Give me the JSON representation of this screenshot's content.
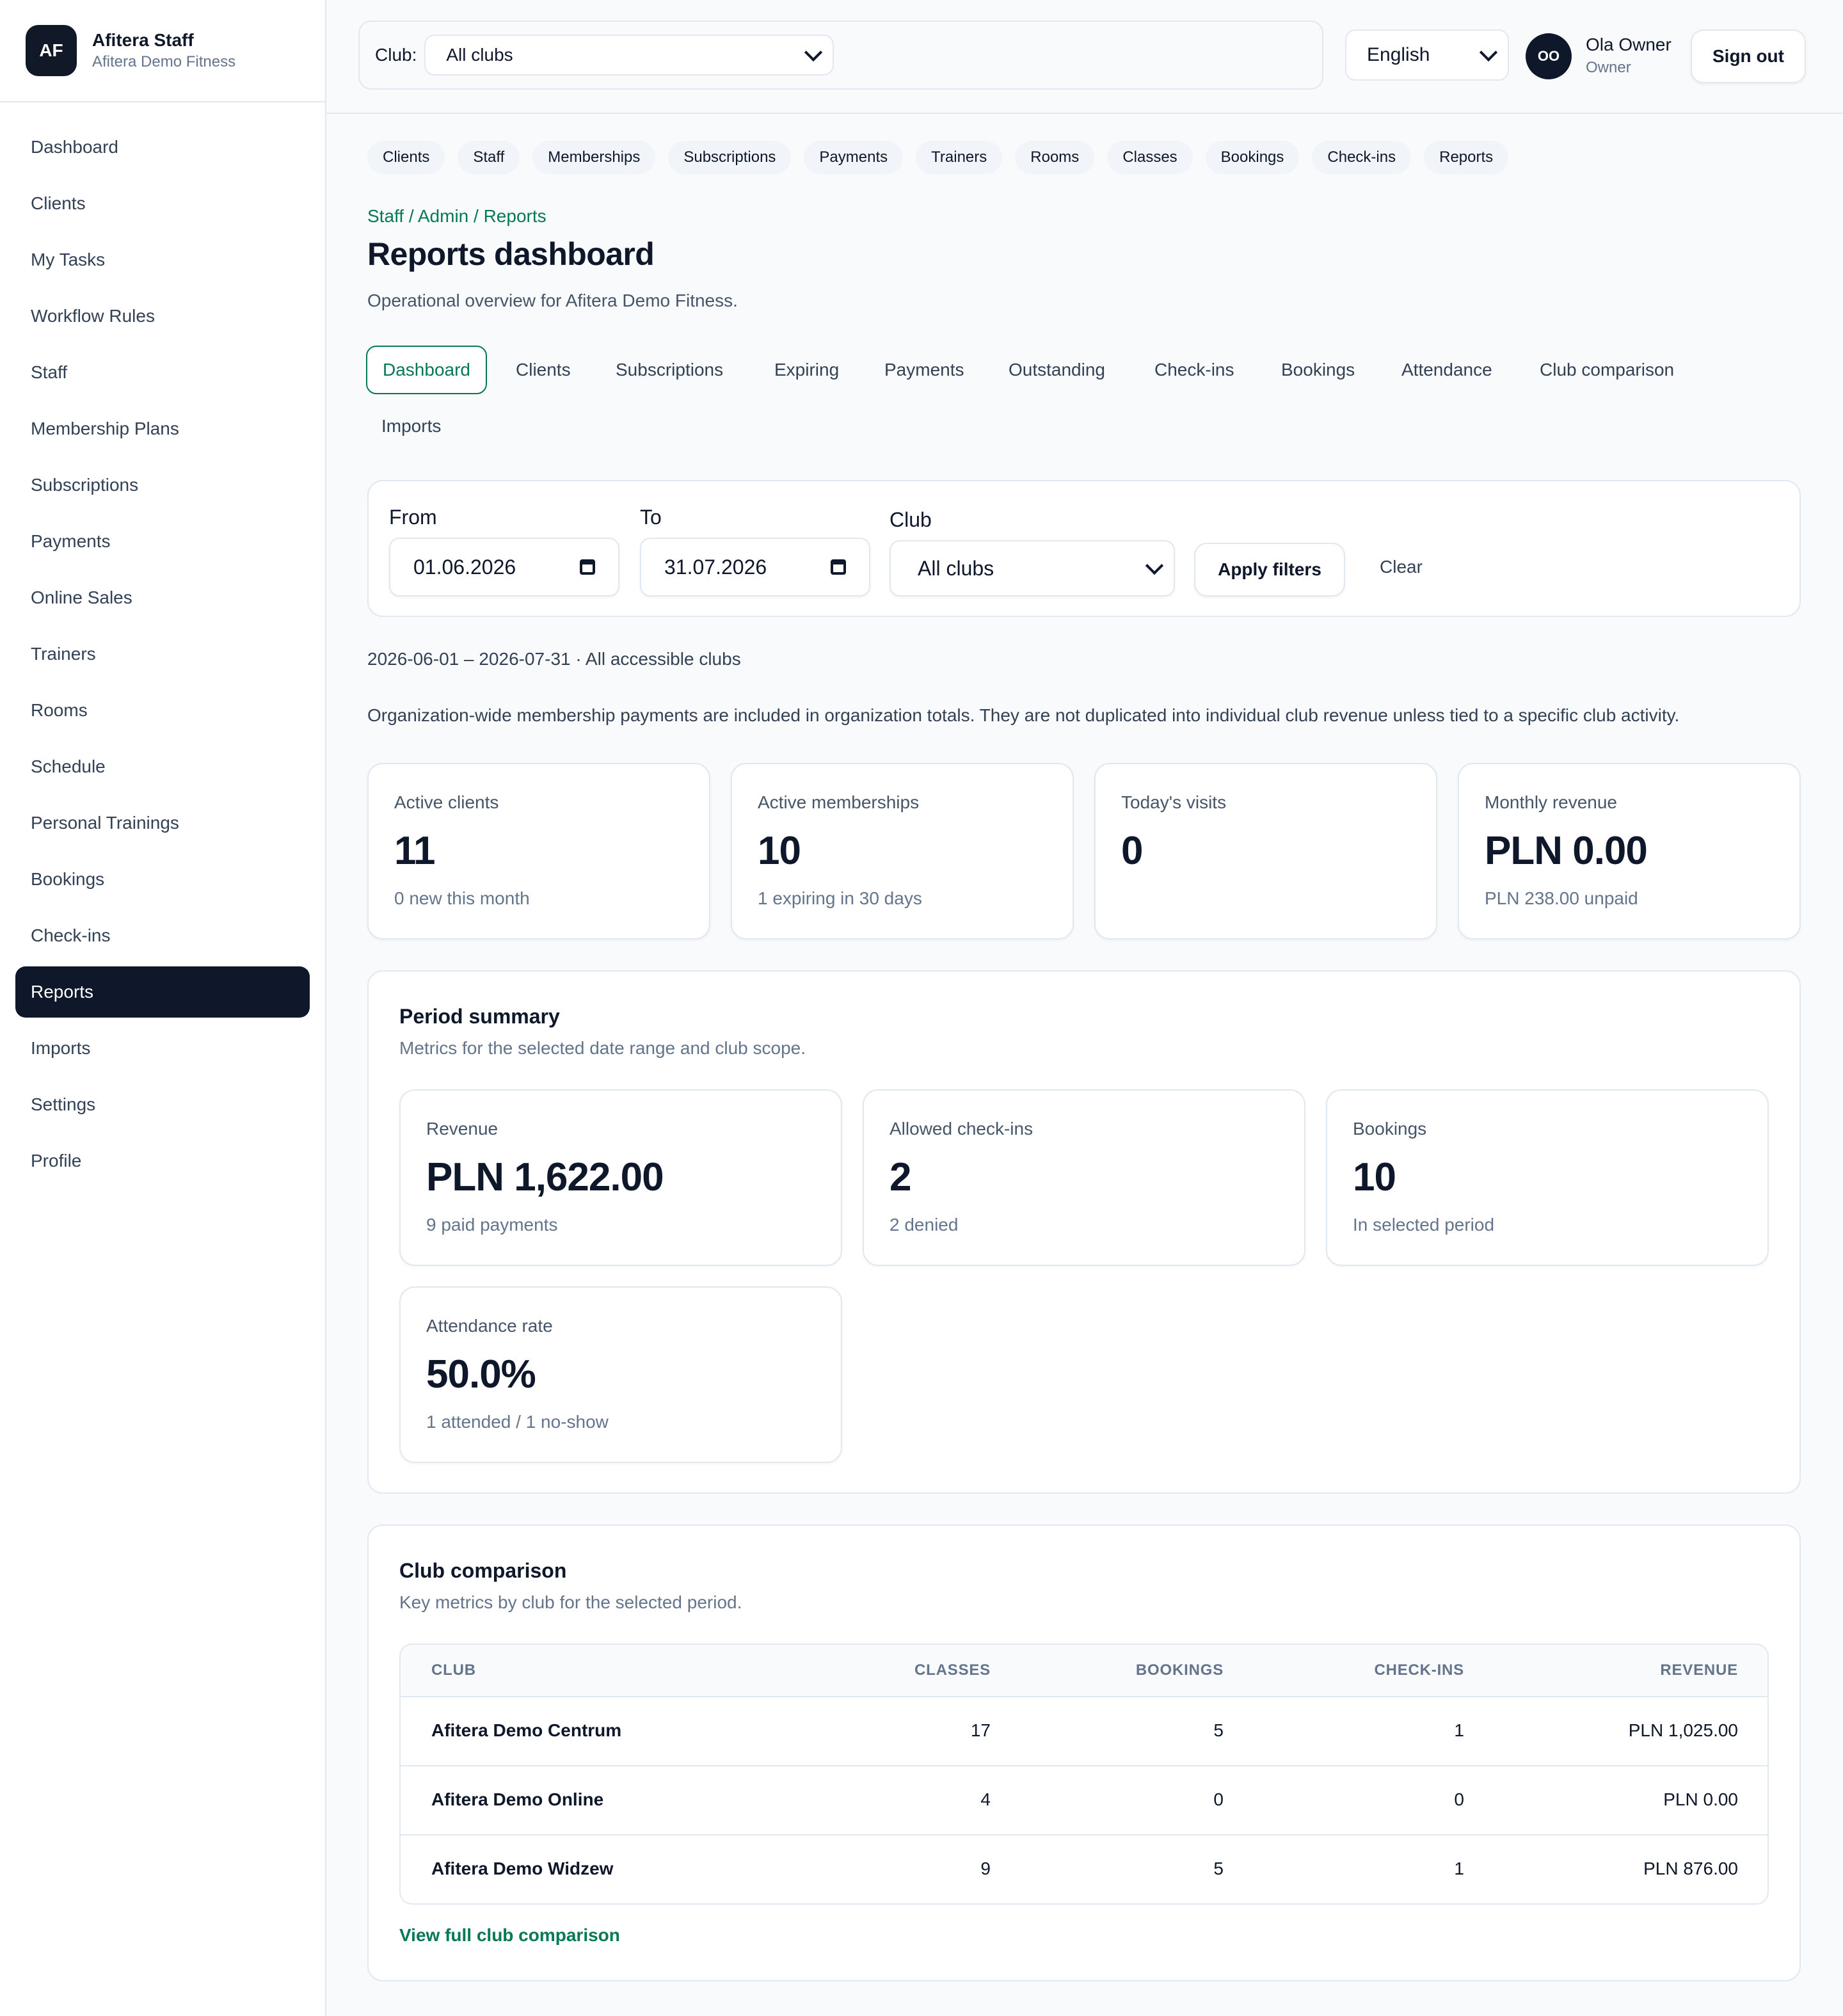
{
  "brand": {
    "initials": "AF",
    "name": "Afitera Staff",
    "org": "Afitera Demo Fitness"
  },
  "sidebar": {
    "items": [
      {
        "label": "Dashboard"
      },
      {
        "label": "Clients"
      },
      {
        "label": "My Tasks"
      },
      {
        "label": "Workflow Rules"
      },
      {
        "label": "Staff"
      },
      {
        "label": "Membership Plans"
      },
      {
        "label": "Subscriptions"
      },
      {
        "label": "Payments"
      },
      {
        "label": "Online Sales"
      },
      {
        "label": "Trainers"
      },
      {
        "label": "Rooms"
      },
      {
        "label": "Schedule"
      },
      {
        "label": "Personal Trainings"
      },
      {
        "label": "Bookings"
      },
      {
        "label": "Check-ins"
      },
      {
        "label": "Reports"
      },
      {
        "label": "Imports"
      },
      {
        "label": "Settings"
      },
      {
        "label": "Profile"
      }
    ],
    "active": "Reports"
  },
  "header": {
    "club_label": "Club:",
    "club_value": "All clubs",
    "language": "English",
    "user_initials": "OO",
    "user_name": "Ola Owner",
    "user_role": "Owner",
    "signout": "Sign out"
  },
  "quicklinks": [
    "Clients",
    "Staff",
    "Memberships",
    "Subscriptions",
    "Payments",
    "Trainers",
    "Rooms",
    "Classes",
    "Bookings",
    "Check-ins",
    "Reports"
  ],
  "page": {
    "breadcrumb": "Staff / Admin / Reports",
    "title": "Reports dashboard",
    "subtitle": "Operational overview for Afitera Demo Fitness."
  },
  "tabs": [
    "Dashboard",
    "Clients",
    "Subscriptions",
    "Expiring",
    "Payments",
    "Outstanding",
    "Check-ins",
    "Bookings",
    "Attendance",
    "Club comparison",
    "Imports"
  ],
  "filters": {
    "from_label": "From",
    "from_value": "01.06.2026",
    "to_label": "To",
    "to_value": "31.07.2026",
    "club_label": "Club",
    "club_value": "All clubs",
    "apply": "Apply filters",
    "clear": "Clear"
  },
  "range_text": "2026-06-01 – 2026-07-31 · All accessible clubs",
  "note": "Organization-wide membership payments are included in organization totals. They are not duplicated into individual club revenue unless tied to a specific club activity.",
  "stats": [
    {
      "label": "Active clients",
      "value": "11",
      "sub": "0 new this month"
    },
    {
      "label": "Active memberships",
      "value": "10",
      "sub": "1 expiring in 30 days"
    },
    {
      "label": "Today's visits",
      "value": "0",
      "sub": ""
    },
    {
      "label": "Monthly revenue",
      "value": "PLN 0.00",
      "sub": "PLN 238.00 unpaid"
    }
  ],
  "period": {
    "title": "Period summary",
    "subtitle": "Metrics for the selected date range and club scope.",
    "metrics": [
      {
        "label": "Revenue",
        "value": "PLN 1,622.00",
        "sub": "9 paid payments"
      },
      {
        "label": "Allowed check-ins",
        "value": "2",
        "sub": "2 denied"
      },
      {
        "label": "Bookings",
        "value": "10",
        "sub": "In selected period"
      },
      {
        "label": "Attendance rate",
        "value": "50.0%",
        "sub": "1 attended / 1 no-show"
      }
    ]
  },
  "comparison": {
    "title": "Club comparison",
    "subtitle": "Key metrics by club for the selected period.",
    "columns": [
      "CLUB",
      "CLASSES",
      "BOOKINGS",
      "CHECK-INS",
      "REVENUE"
    ],
    "rows": [
      [
        "Afitera Demo Centrum",
        "17",
        "5",
        "1",
        "PLN 1,025.00"
      ],
      [
        "Afitera Demo Online",
        "4",
        "0",
        "0",
        "PLN 0.00"
      ],
      [
        "Afitera Demo Widzew",
        "9",
        "5",
        "1",
        "PLN 876.00"
      ]
    ],
    "link": "View full club comparison"
  }
}
